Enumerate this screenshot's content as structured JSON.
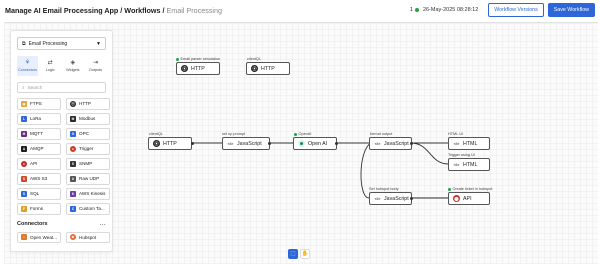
{
  "header": {
    "breadcrumb_main": "Manage AI Email Processing App / Workflows",
    "breadcrumb_separator": "/",
    "breadcrumb_current": "Email Processing",
    "connection_count": "1",
    "timestamp": "26-May-2025 08:28:12",
    "workflow_versions_label": "Workflow Versions",
    "save_workflow_label": "Save Workflow",
    "accent_color": "#2d66d8",
    "status_color": "#22a347"
  },
  "panel": {
    "selected_workflow": "Email Processing",
    "tabs": [
      {
        "label": "Connectors",
        "icon": "connectors-icon",
        "active": true
      },
      {
        "label": "Logic",
        "icon": "logic-icon",
        "active": false
      },
      {
        "label": "Widgets",
        "icon": "widgets-icon",
        "active": false
      },
      {
        "label": "Outputs",
        "icon": "outputs-icon",
        "active": false
      }
    ],
    "search_placeholder": "Search",
    "items": [
      {
        "label": "FTPS",
        "color": "#e8a23a"
      },
      {
        "label": "HTTP",
        "color": "#1f1f1f"
      },
      {
        "label": "LoRa",
        "color": "#2d66d8"
      },
      {
        "label": "Modbus",
        "color": "#2a2a2a"
      },
      {
        "label": "MQTT",
        "color": "#6b2a86"
      },
      {
        "label": "OPC",
        "color": "#2d66d8"
      },
      {
        "label": "AMQP",
        "color": "#1f1f1f"
      },
      {
        "label": "Trigger",
        "color": "#d03a2a"
      },
      {
        "label": "API",
        "color": "#c82a2a"
      },
      {
        "label": "SNMP",
        "color": "#333333"
      },
      {
        "label": "AWS S3",
        "color": "#d04a2a"
      },
      {
        "label": "Raw UDP",
        "color": "#555555"
      },
      {
        "label": "SQL",
        "color": "#2d66d8"
      },
      {
        "label": "AWS Kinesis",
        "color": "#6b3fa0"
      },
      {
        "label": "Forms",
        "color": "#e0a020"
      },
      {
        "label": "Custom Ta...",
        "color": "#2d66d8"
      }
    ],
    "section_title": "Connectors",
    "section_more": "...",
    "connectors": [
      {
        "label": "Open Weat...",
        "color": "#e07a2a"
      },
      {
        "label": "Hubspot",
        "color": "#e8683a"
      }
    ]
  },
  "nodes": [
    {
      "id": "n1",
      "label": "Email parser simulation",
      "text": "HTTP",
      "kind": "http"
    },
    {
      "id": "n2",
      "label": "clientQL",
      "text": "HTTP",
      "kind": "http"
    },
    {
      "id": "n3",
      "label": "clientQL",
      "text": "HTTP",
      "kind": "http"
    },
    {
      "id": "n4",
      "label": "set up prompt",
      "text": "JavaScript",
      "kind": "code"
    },
    {
      "id": "n5",
      "label": "OpenAI",
      "text": "Open AI",
      "kind": "ai"
    },
    {
      "id": "n6",
      "label": "format output",
      "text": "JavaScript",
      "kind": "code"
    },
    {
      "id": "n7",
      "label": "HTML UI",
      "text": "HTML",
      "kind": "html"
    },
    {
      "id": "n8",
      "label": "Trigger using UI",
      "text": "HTML",
      "kind": "html"
    },
    {
      "id": "n9",
      "label": "Set hubspot body",
      "text": "JavaScript",
      "kind": "code"
    },
    {
      "id": "n10",
      "label": "Create ticket in hubspot",
      "text": "API",
      "kind": "api"
    }
  ],
  "toolbar": {
    "select_tool_icon": "cursor-icon",
    "pan_tool_icon": "hand-icon"
  }
}
